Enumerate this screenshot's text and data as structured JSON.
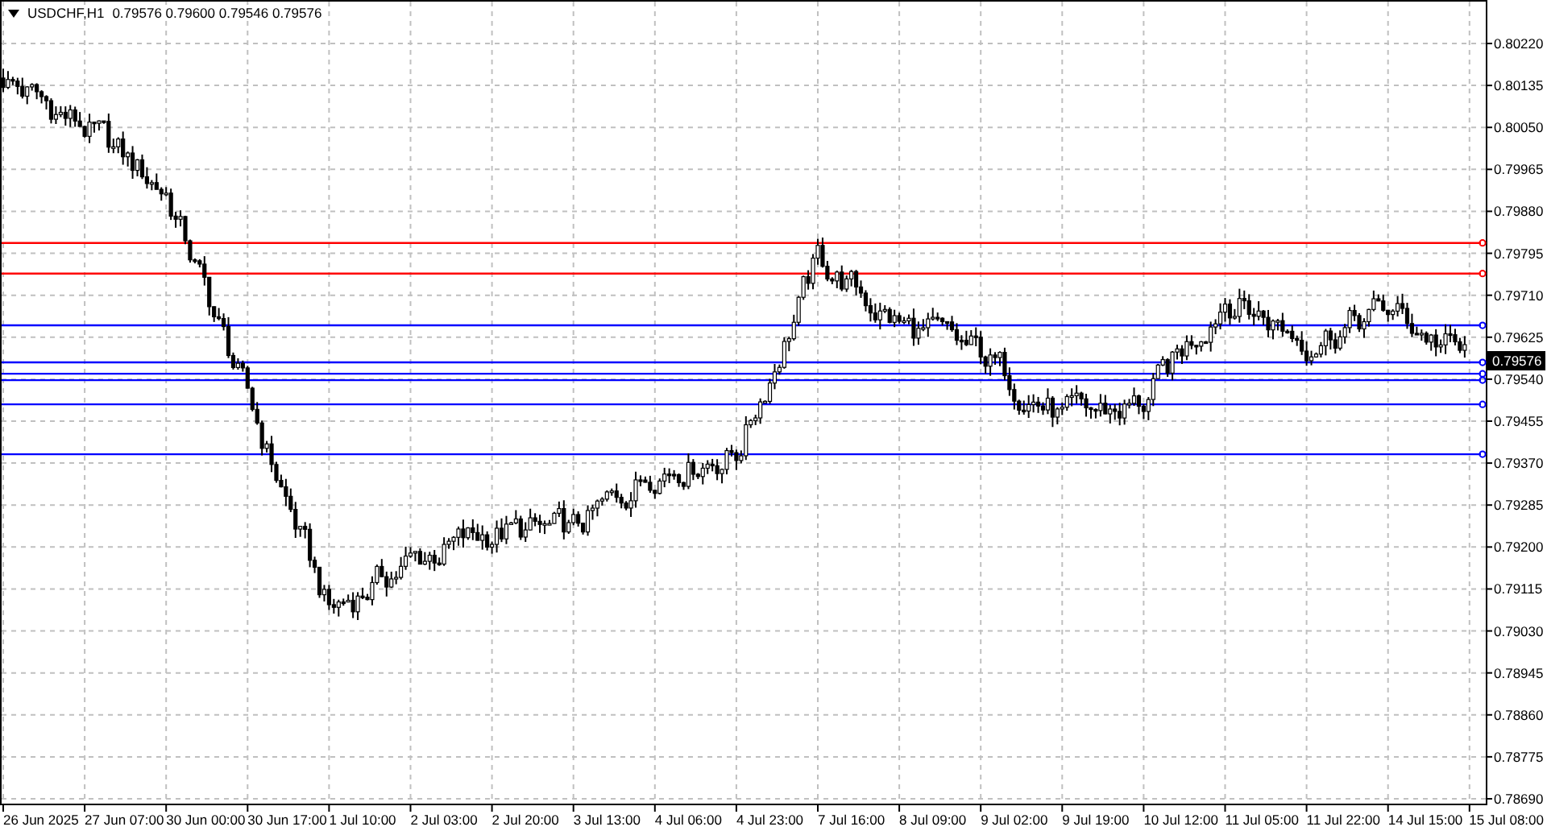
{
  "header": {
    "symbol": "USDCHF,H1",
    "quote": "0.79576 0.79600 0.79546 0.79576"
  },
  "current_price": "0.79576",
  "chart_data": {
    "type": "line",
    "ylim": [
      0.7869,
      0.8022
    ],
    "grid": true,
    "categories": [
      "26 Jun 2025",
      "27 Jun 07:00",
      "30 Jun 00:00",
      "30 Jun 17:00",
      "1 Jul 10:00",
      "2 Jul 03:00",
      "2 Jul 20:00",
      "3 Jul 13:00",
      "4 Jul 06:00",
      "4 Jul 23:00",
      "7 Jul 16:00",
      "8 Jul 09:00",
      "9 Jul 02:00",
      "9 Jul 19:00",
      "10 Jul 12:00",
      "11 Jul 05:00",
      "11 Jul 22:00",
      "14 Jul 15:00",
      "15 Jul 08:00"
    ],
    "yticks": [
      {
        "value": 0.8022,
        "label": "0.80220"
      },
      {
        "value": 0.80135,
        "label": "0.80135"
      },
      {
        "value": 0.8005,
        "label": "0.80050"
      },
      {
        "value": 0.79965,
        "label": "0.79965"
      },
      {
        "value": 0.7988,
        "label": "0.79880"
      },
      {
        "value": 0.79795,
        "label": "0.79795"
      },
      {
        "value": 0.7971,
        "label": "0.79710"
      },
      {
        "value": 0.79625,
        "label": "0.79625"
      },
      {
        "value": 0.7954,
        "label": "0.79540"
      },
      {
        "value": 0.79455,
        "label": "0.79455"
      },
      {
        "value": 0.7937,
        "label": "0.79370"
      },
      {
        "value": 0.79285,
        "label": "0.79285"
      },
      {
        "value": 0.792,
        "label": "0.79200"
      },
      {
        "value": 0.79115,
        "label": "0.79115"
      },
      {
        "value": 0.7903,
        "label": "0.79030"
      },
      {
        "value": 0.78945,
        "label": "0.78945"
      },
      {
        "value": 0.7886,
        "label": "0.78860"
      },
      {
        "value": 0.78775,
        "label": "0.78775"
      },
      {
        "value": 0.7869,
        "label": "0.78690"
      }
    ],
    "ref_lines": [
      {
        "axis": "y",
        "value": 0.79816,
        "color": "#ff0000"
      },
      {
        "axis": "y",
        "value": 0.79754,
        "color": "#ff0000"
      },
      {
        "axis": "y",
        "value": 0.79649,
        "color": "#0000ff"
      },
      {
        "axis": "y",
        "value": 0.79574,
        "color": "#0000ff"
      },
      {
        "axis": "y",
        "value": 0.79551,
        "color": "#0000ff"
      },
      {
        "axis": "y",
        "value": 0.79538,
        "color": "#0000ff"
      },
      {
        "axis": "y",
        "value": 0.79489,
        "color": "#0000ff"
      },
      {
        "axis": "y",
        "value": 0.79388,
        "color": "#0000ff"
      }
    ]
  }
}
